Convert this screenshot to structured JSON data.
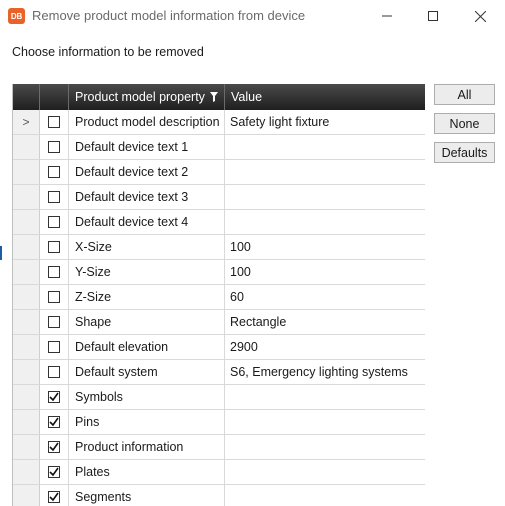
{
  "window": {
    "app_icon_text": "DB",
    "title": "Remove product model information from device"
  },
  "instruction": "Choose information to be removed",
  "grid": {
    "columns": {
      "property": "Product model property",
      "value": "Value"
    },
    "current_row_marker": ">",
    "rows": [
      {
        "property": "Product model description",
        "value": "Safety light fixture",
        "checked": false
      },
      {
        "property": "Default device text 1",
        "value": "",
        "checked": false
      },
      {
        "property": "Default device text 2",
        "value": "",
        "checked": false
      },
      {
        "property": "Default device text 3",
        "value": "",
        "checked": false
      },
      {
        "property": "Default device text 4",
        "value": "",
        "checked": false
      },
      {
        "property": "X-Size",
        "value": "100",
        "checked": false
      },
      {
        "property": "Y-Size",
        "value": "100",
        "checked": false
      },
      {
        "property": "Z-Size",
        "value": "60",
        "checked": false
      },
      {
        "property": "Shape",
        "value": "Rectangle",
        "checked": false
      },
      {
        "property": "Default elevation",
        "value": "2900",
        "checked": false
      },
      {
        "property": "Default system",
        "value": "S6, Emergency lighting systems",
        "checked": false
      },
      {
        "property": "Symbols",
        "value": "",
        "checked": true
      },
      {
        "property": "Pins",
        "value": "",
        "checked": true
      },
      {
        "property": "Product information",
        "value": "",
        "checked": true
      },
      {
        "property": "Plates",
        "value": "",
        "checked": true
      },
      {
        "property": "Segments",
        "value": "",
        "checked": true
      }
    ]
  },
  "buttons": {
    "all": "All",
    "none": "None",
    "defaults": "Defaults"
  },
  "colors": {
    "app_icon": "#e8622a",
    "header_dark": "#1f1f1f",
    "selector_column": "#f0f0f0",
    "button_face": "#ececec"
  },
  "icons": {
    "app": "db-app-icon",
    "minimize": "minimize-icon",
    "maximize": "maximize-icon",
    "close": "close-icon",
    "filter": "filter-icon",
    "check": "checkmark-icon"
  }
}
